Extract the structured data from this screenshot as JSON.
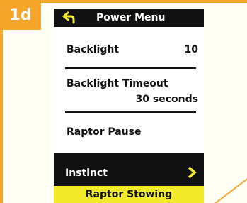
{
  "step": {
    "badge": "1d"
  },
  "menu": {
    "title": "Power Menu",
    "back_icon": "back-arrow-icon",
    "items": [
      {
        "label": "Backlight",
        "value": "10"
      },
      {
        "label": "Backlight Timeout",
        "value": "30 seconds"
      },
      {
        "label": "Raptor Pause",
        "value": ""
      }
    ],
    "selected": {
      "label": "Instinct",
      "icon": "chevron-right-icon"
    },
    "footer": "Raptor Stowing"
  },
  "colors": {
    "accent": "#f5a52a",
    "screen_bg": "#ffffff",
    "title_bar": "#111111",
    "highlight": "#f2ea2a"
  }
}
